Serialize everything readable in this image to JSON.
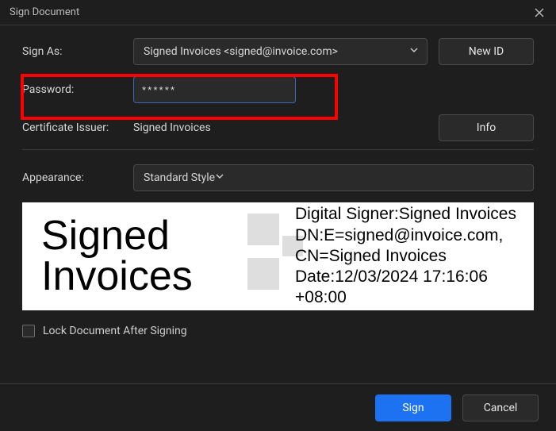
{
  "dialog": {
    "title": "Sign Document"
  },
  "signAs": {
    "label": "Sign As:",
    "selected": "Signed Invoices <signed@invoice.com>",
    "newIdLabel": "New ID"
  },
  "password": {
    "label": "Password:",
    "value": "******"
  },
  "issuer": {
    "label": "Certificate Issuer:",
    "value": "Signed Invoices",
    "infoLabel": "Info"
  },
  "appearance": {
    "label": "Appearance:",
    "selected": "Standard Style"
  },
  "signaturePreview": {
    "name": "Signed Invoices",
    "detailsText": "Digital Signer:Signed Invoices\nDN:E=signed@invoice.com,\nCN=Signed Invoices\nDate:12/03/2024 17:16:06\n+08:00"
  },
  "lock": {
    "label": "Lock Document After Signing",
    "checked": false
  },
  "footer": {
    "signLabel": "Sign",
    "cancelLabel": "Cancel"
  }
}
